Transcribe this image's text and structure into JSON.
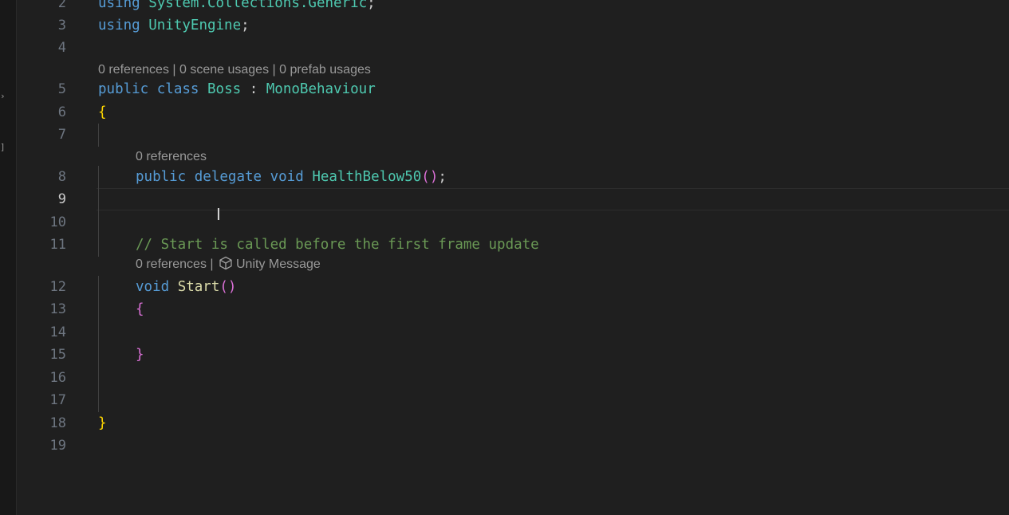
{
  "gutter": {
    "line_numbers": [
      "2",
      "3",
      "4",
      "5",
      "6",
      "7",
      "8",
      "9",
      "10",
      "11",
      "12",
      "13",
      "14",
      "15",
      "16",
      "17",
      "18",
      "19"
    ],
    "active_line": "9"
  },
  "lines": {
    "l2": {
      "kw": "using",
      "ns": "System.Collections.Generic",
      "end": ";"
    },
    "l3": {
      "kw": "using",
      "ns": "UnityEngine",
      "end": ";"
    },
    "l5": {
      "kw1": "public",
      "kw2": "class",
      "name": "Boss",
      "colon": " : ",
      "base": "MonoBehaviour"
    },
    "l6": {
      "brace": "{"
    },
    "l8": {
      "kw1": "public",
      "kw2": "delegate",
      "kw3": "void",
      "name": "HealthBelow50",
      "paren": "()",
      "end": ";"
    },
    "l11": {
      "comment": "// Start is called before the first frame update"
    },
    "l12": {
      "kw": "void",
      "name": "Start",
      "paren": "()"
    },
    "l13": {
      "brace": "{"
    },
    "l15": {
      "brace": "}"
    },
    "l18": {
      "brace": "}"
    }
  },
  "codelens": {
    "class_boss": "0 references | 0 scene usages | 0 prefab usages",
    "delegate": "0 references",
    "start_refs": "0 references | ",
    "start_tag": "Unity Message"
  },
  "colors": {
    "keyword": "#569cd6",
    "type": "#4ec9b0",
    "function": "#dcdcaa",
    "comment": "#6a9955",
    "bracket_level1": "#ffd700",
    "bracket_level2": "#da70d6",
    "background": "#1f1f1f"
  },
  "icons": {
    "cursor": "text-cursor-icon",
    "unity_message": "cube-icon"
  }
}
